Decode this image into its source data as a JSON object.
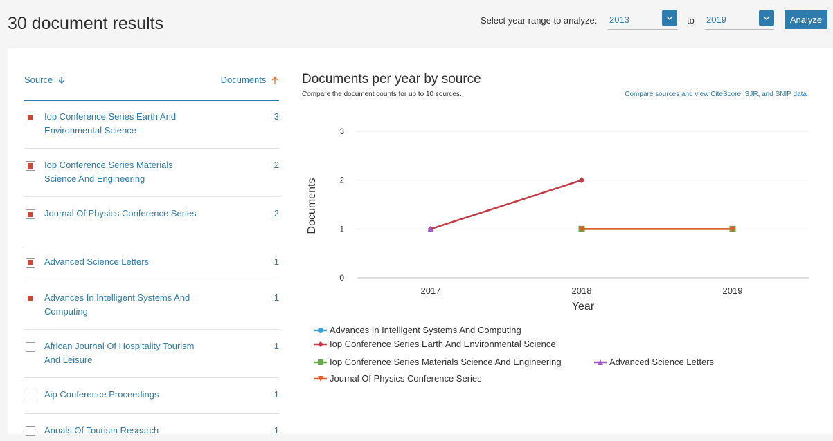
{
  "header": {
    "title": "30 document results",
    "range_label": "Select year range to analyze:",
    "from_year": "2013",
    "to_label": "to",
    "to_year": "2019",
    "analyze_label": "Analyze"
  },
  "sources": {
    "source_header": "Source",
    "documents_header": "Documents",
    "items": [
      {
        "name": "Iop Conference Series Earth And Environmental Science",
        "count": "3",
        "checked": true
      },
      {
        "name": "Iop Conference Series Materials Science And Engineering",
        "count": "2",
        "checked": true
      },
      {
        "name": "Journal Of Physics Conference Series",
        "count": "2",
        "checked": true
      },
      {
        "name": "Advanced Science Letters",
        "count": "1",
        "checked": true
      },
      {
        "name": "Advances In Intelligent Systems And Computing",
        "count": "1",
        "checked": true
      },
      {
        "name": "African Journal Of Hospitality Tourism And Leisure",
        "count": "1",
        "checked": false
      },
      {
        "name": "Aip Conference Proceedings",
        "count": "1",
        "checked": false
      },
      {
        "name": "Annals Of Tourism Research",
        "count": "1",
        "checked": false
      }
    ]
  },
  "chart": {
    "title": "Documents per year by source",
    "subtitle": "Compare the document counts for up to 10 sources.",
    "link": "Compare sources and view CiteScore, SJR, and SNIP data"
  },
  "chart_data": {
    "type": "line",
    "x": [
      "2017",
      "2018",
      "2019"
    ],
    "xlabel": "Year",
    "ylabel": "Documents",
    "ylim": [
      0,
      3
    ],
    "yticks": [
      "0",
      "1",
      "2",
      "3"
    ],
    "grid": true,
    "legend_position": "bottom-left",
    "series": [
      {
        "name": "Advances In Intelligent Systems And Computing",
        "color": "#3aa2d3",
        "marker": "circle",
        "points": []
      },
      {
        "name": "Iop Conference Series Earth And Environmental Science",
        "color": "#c33b45",
        "marker": "diamond",
        "points": [
          [
            "2017",
            1
          ],
          [
            "2018",
            2
          ]
        ]
      },
      {
        "name": "Iop Conference Series Materials Science And Engineering",
        "color": "#6aa84f",
        "marker": "square",
        "points": [
          [
            "2018",
            1
          ],
          [
            "2019",
            1
          ]
        ]
      },
      {
        "name": "Advanced Science Letters",
        "color": "#9d5bc0",
        "marker": "triangle",
        "points": [
          [
            "2017",
            1
          ]
        ]
      },
      {
        "name": "Journal Of Physics Conference Series",
        "color": "#e45b26",
        "marker": "triangle-down",
        "points": [
          [
            "2018",
            1
          ],
          [
            "2019",
            1
          ]
        ]
      }
    ]
  }
}
